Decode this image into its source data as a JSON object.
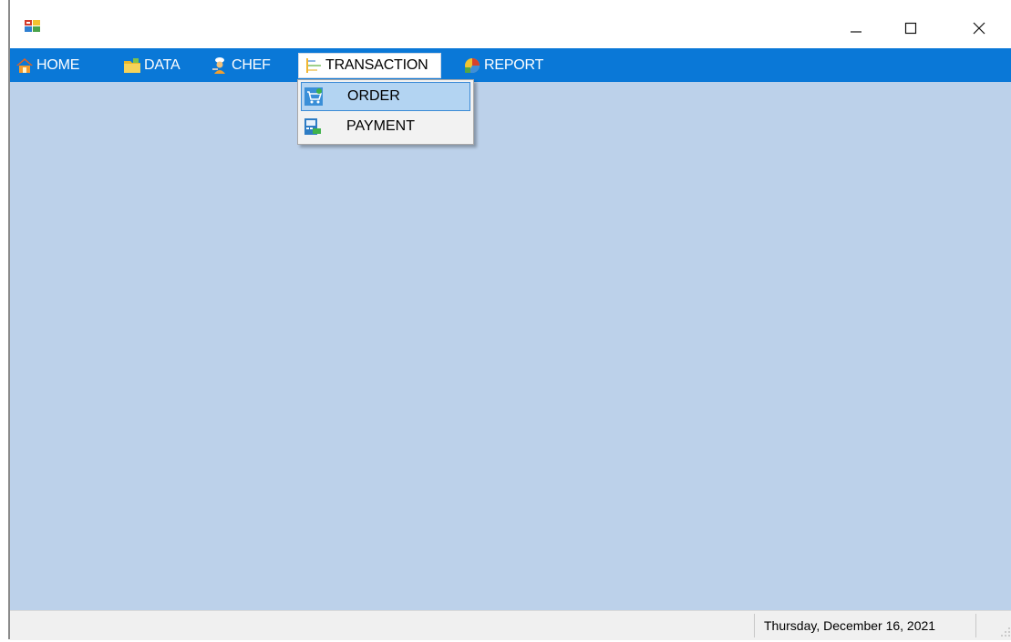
{
  "window": {
    "controls": {
      "minimize": "—",
      "maximize": "☐",
      "close": "✕"
    }
  },
  "menu": {
    "items": [
      {
        "label": "HOME",
        "icon": "home-icon"
      },
      {
        "label": "DATA",
        "icon": "folder-icon"
      },
      {
        "label": "CHEF",
        "icon": "chef-icon"
      },
      {
        "label": "TRANSACTION",
        "icon": "transaction-icon",
        "active": true
      },
      {
        "label": "REPORT",
        "icon": "report-icon"
      }
    ],
    "dropdown": {
      "items": [
        {
          "label": "ORDER",
          "icon": "cart-icon",
          "highlighted": true
        },
        {
          "label": "PAYMENT",
          "icon": "payment-icon"
        }
      ]
    }
  },
  "status": {
    "date": "Thursday, December 16, 2021"
  },
  "colors": {
    "menubar": "#0a78d7",
    "client": "#bcd1ea",
    "highlight": "#b3d4f2"
  }
}
